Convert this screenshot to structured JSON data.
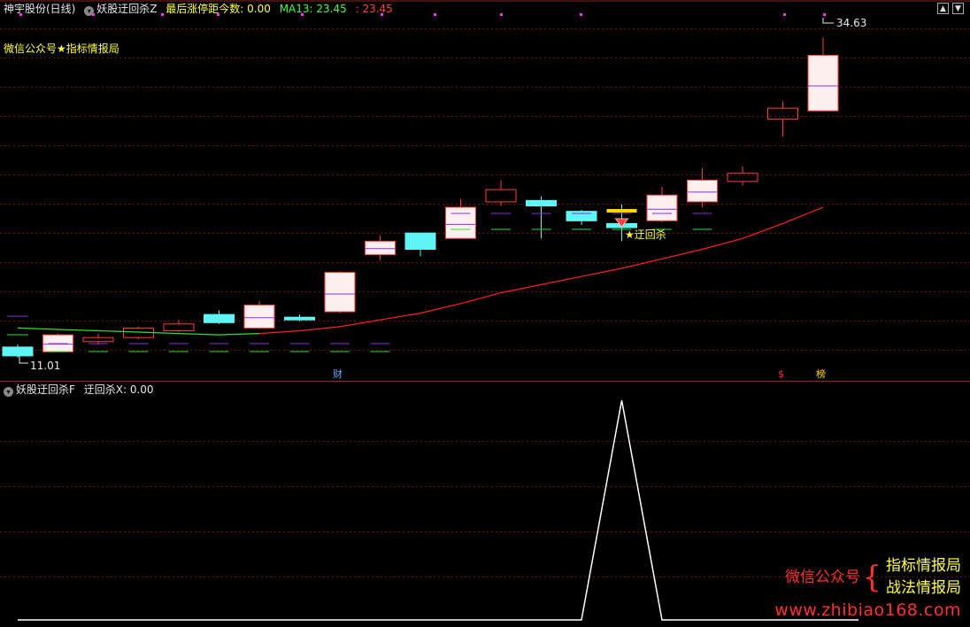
{
  "top_header": {
    "stock_name": "神宇股份(日线)",
    "indicator_name": "妖股迂回杀Z",
    "days_label": "最后涨停距今数:",
    "days_value": "0.00",
    "ma_label": "MA13:",
    "ma_value": "23.45",
    "ma_value2": "23.45"
  },
  "note_text": "微信公众号★指标情报局",
  "price_labels": {
    "high": "34.63",
    "low": "11.01"
  },
  "signal_label": "★迂回杀",
  "markers": {
    "cai": "财",
    "dollar": "$",
    "bang": "榜"
  },
  "bottom_header": {
    "indicator_name": "妖股迂回杀F",
    "value_label": "迂回杀X:",
    "value": "0.00"
  },
  "watermark": {
    "left": "微信公众号",
    "brace": "{",
    "right1": "指标情报局",
    "right2": "战法情报局",
    "url": "www.zhibiao168.com"
  },
  "nav_icons": {
    "up": "up-arrow-icon",
    "down": "down-arrow-icon",
    "toggle": "circle-toggle-icon"
  },
  "colors": {
    "background": "#000000",
    "up_candle": "#ff3b3b",
    "up_fill": "#fff0f0",
    "down_candle": "#5ff5f5",
    "ma_line": "#ff2020",
    "base_line": "#30e030",
    "grid": "#7a1010",
    "osc_line": "#ffffff",
    "mark_purple": "#8a30e0"
  },
  "chart_data": {
    "type": "candlestick",
    "title": "神宇股份(日线)",
    "ylim": [
      11.01,
      34.63
    ],
    "candles": [
      {
        "o": 11.8,
        "c": 11.15,
        "h": 12.0,
        "l": 11.01
      },
      {
        "o": 11.45,
        "c": 12.7,
        "h": 12.8,
        "l": 11.4
      },
      {
        "o": 12.2,
        "c": 12.5,
        "h": 12.8,
        "l": 12.0
      },
      {
        "o": 12.5,
        "c": 13.2,
        "h": 13.3,
        "l": 12.4
      },
      {
        "o": 13.0,
        "c": 13.5,
        "h": 13.8,
        "l": 12.9
      },
      {
        "o": 14.2,
        "c": 13.6,
        "h": 14.5,
        "l": 13.5
      },
      {
        "o": 13.2,
        "c": 14.9,
        "h": 15.2,
        "l": 13.1
      },
      {
        "o": 14.0,
        "c": 13.8,
        "h": 14.2,
        "l": 13.7
      },
      {
        "o": 14.4,
        "c": 17.3,
        "h": 17.4,
        "l": 14.3
      },
      {
        "o": 18.6,
        "c": 19.6,
        "h": 20.0,
        "l": 18.2
      },
      {
        "o": 20.2,
        "c": 19.0,
        "h": 20.2,
        "l": 18.5
      },
      {
        "o": 19.8,
        "c": 22.1,
        "h": 22.7,
        "l": 19.8
      },
      {
        "o": 22.5,
        "c": 23.4,
        "h": 24.1,
        "l": 22.2
      },
      {
        "o": 22.6,
        "c": 22.2,
        "h": 22.9,
        "l": 19.8
      },
      {
        "o": 21.8,
        "c": 21.1,
        "h": 21.9,
        "l": 20.8
      },
      {
        "o": 20.9,
        "c": 20.6,
        "h": 22.3,
        "l": 19.6
      },
      {
        "o": 21.1,
        "c": 23.0,
        "h": 23.6,
        "l": 21.0
      },
      {
        "o": 22.5,
        "c": 24.1,
        "h": 25.0,
        "l": 22.1
      },
      {
        "o": 24.0,
        "c": 24.6,
        "h": 25.1,
        "l": 23.7
      },
      {
        "o": 28.6,
        "c": 29.4,
        "h": 29.9,
        "l": 27.3
      },
      {
        "o": 29.2,
        "c": 33.3,
        "h": 34.63,
        "l": 29.2
      }
    ],
    "ma13": [
      13.2,
      13.1,
      13.0,
      12.9,
      12.8,
      12.7,
      12.8,
      13.0,
      13.3,
      13.8,
      14.3,
      15.0,
      15.8,
      16.4,
      17.0,
      17.6,
      18.3,
      19.0,
      19.8,
      20.9,
      22.1
    ],
    "oscillator": {
      "label": "迂回杀X",
      "values": [
        0,
        0,
        0,
        0,
        0,
        0,
        0,
        0,
        0,
        0,
        0,
        0,
        0,
        0,
        0,
        1,
        0,
        0,
        0,
        0,
        0
      ],
      "ylim": [
        0,
        1
      ]
    }
  }
}
